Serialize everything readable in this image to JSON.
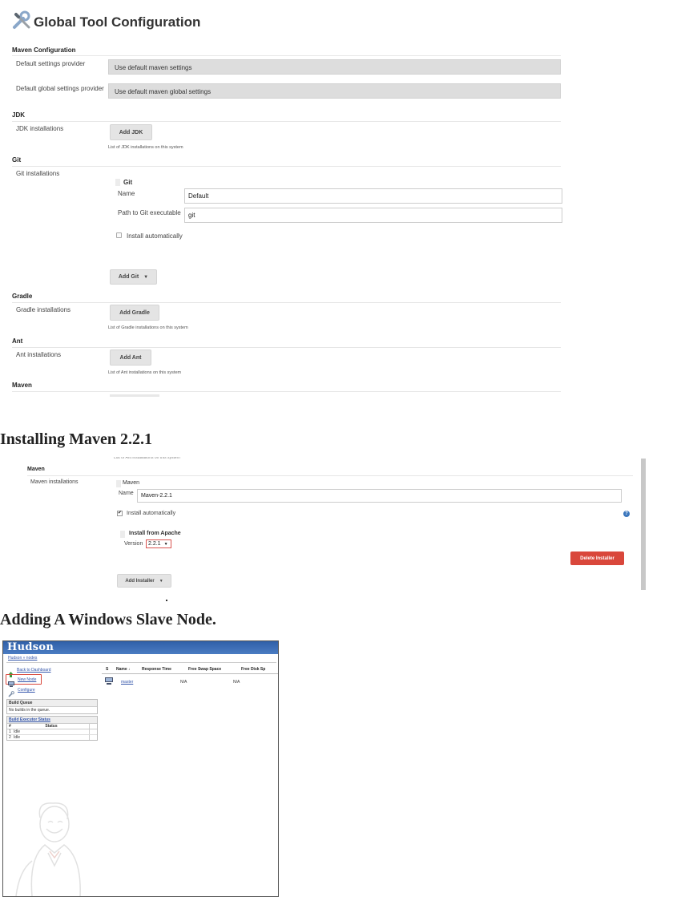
{
  "global_tool_config": {
    "title": "Global Tool Configuration",
    "maven_configuration": {
      "heading": "Maven Configuration",
      "default_settings_label": "Default settings provider",
      "default_settings_value": "Use default maven settings",
      "default_global_settings_label": "Default global settings provider",
      "default_global_settings_value": "Use default maven global settings"
    },
    "jdk": {
      "heading": "JDK",
      "installations_label": "JDK installations",
      "add_button": "Add JDK",
      "hint": "List of JDK installations on this system"
    },
    "git": {
      "heading": "Git",
      "installations_label": "Git installations",
      "entry_title": "Git",
      "name_label": "Name",
      "name_value": "Default",
      "path_label": "Path to Git executable",
      "path_value": "git",
      "install_auto_label": "Install automatically",
      "add_button": "Add Git"
    },
    "gradle": {
      "heading": "Gradle",
      "installations_label": "Gradle installations",
      "add_button": "Add Gradle",
      "hint": "List of Gradle installations on this system"
    },
    "ant": {
      "heading": "Ant",
      "installations_label": "Ant installations",
      "add_button": "Add Ant",
      "hint": "List of Ant installations on this system"
    },
    "maven": {
      "heading": "Maven"
    }
  },
  "heading_installing_maven": "Installing Maven 2.2.1",
  "maven_install": {
    "cut_hint": "List of Ant installations on this system",
    "heading": "Maven",
    "installations_label": "Maven installations",
    "entry_title": "Maven",
    "name_label": "Name",
    "name_value": "Maven-2.2.1",
    "install_auto_label": "Install automatically",
    "install_from_label": "Install from Apache",
    "version_label": "Version",
    "version_value": "2.2.1",
    "delete_button": "Delete Installer",
    "add_installer_button": "Add Installer"
  },
  "heading_adding_node": "Adding A Windows Slave Node.",
  "hudson": {
    "brand": "Hudson",
    "breadcrumb": "Hudson » nodes",
    "side_links": [
      "Back to Dashboard",
      "New Node",
      "Configure"
    ],
    "build_queue": {
      "title": "Build Queue",
      "empty": "No builds in the queue."
    },
    "executor_status": {
      "title": "Build Executor Status",
      "col_num": "#",
      "col_status": "Status",
      "rows": [
        {
          "num": "1",
          "status": "Idle"
        },
        {
          "num": "2",
          "status": "Idle"
        }
      ]
    },
    "table": {
      "columns": [
        "S",
        "Name ↓",
        "Response Time",
        "Free Swap Space",
        "Free Disk Sp"
      ],
      "rows": [
        {
          "name": "master",
          "response": "N/A",
          "swap": "N/A"
        }
      ]
    }
  },
  "colors": {
    "delete_button": "#d9473b",
    "hudson_banner": "#3a6bb3",
    "link": "#3355aa"
  }
}
